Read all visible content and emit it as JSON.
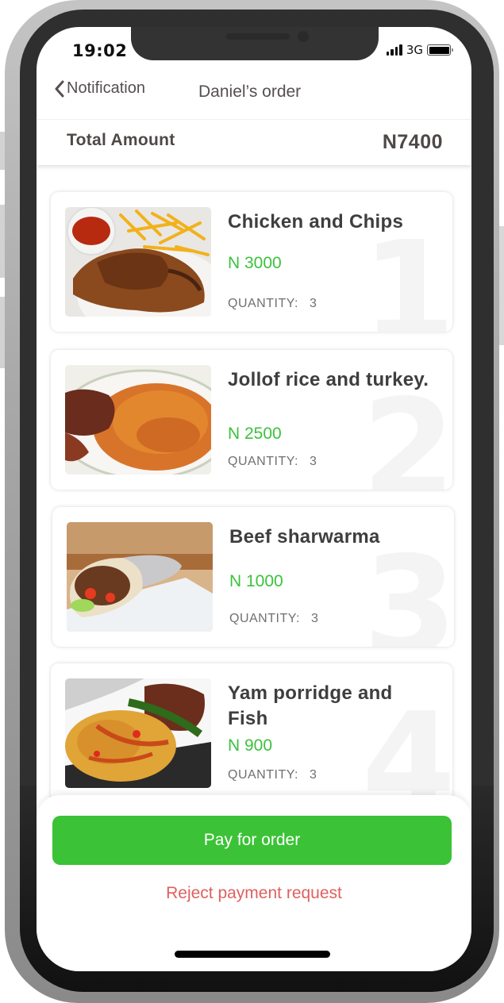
{
  "status_bar": {
    "time": "19:02",
    "network": "3G",
    "signal_icon": "signal-bars-icon",
    "battery_icon": "battery-full-icon",
    "battery_level": 1.0
  },
  "nav": {
    "back_label": "Notification",
    "back_icon": "chevron-left-icon",
    "title": "Daniel’s order"
  },
  "summary": {
    "total_label": "Total Amount",
    "total_value": "N7400"
  },
  "orders": [
    {
      "index": "1",
      "name": "Chicken and Chips",
      "price": "N 3000",
      "quantity_label": "QUANTITY:",
      "quantity": "3",
      "image": "chicken-and-chips-photo"
    },
    {
      "index": "2",
      "name": "Jollof rice and turkey.",
      "price": "N 2500",
      "quantity_label": "QUANTITY:",
      "quantity": "3",
      "image": "jollof-rice-photo"
    },
    {
      "index": "3",
      "name": "Beef sharwarma",
      "price": "N 1000",
      "quantity_label": "QUANTITY:",
      "quantity": "3",
      "image": "beef-sharwarma-photo"
    },
    {
      "index": "4",
      "name": "Yam porridge and Fish",
      "price": "N 900",
      "quantity_label": "QUANTITY:",
      "quantity": "3",
      "image": "yam-porridge-photo"
    }
  ],
  "actions": {
    "pay_label": "Pay for order",
    "reject_label": "Reject payment request"
  },
  "colors": {
    "accent_green": "#3bc236",
    "price_green": "#3cc23c",
    "reject_red": "#e06060",
    "text_dark": "#4e4847"
  }
}
